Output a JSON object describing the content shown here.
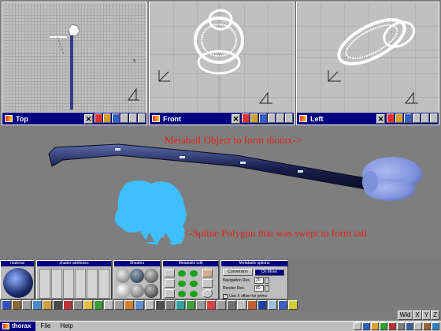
{
  "viewports": [
    {
      "title": "Top"
    },
    {
      "title": "Front"
    },
    {
      "title": "Left"
    }
  ],
  "render": {
    "annotation_metaball": "Metaball Object to form thorax->",
    "annotation_spline": "<-Spline Polygon that was swept to form tail",
    "annotation_color": "#e2231a",
    "spline_color": "#3fbfff",
    "metaball_color": "#8fa6e8"
  },
  "panels": {
    "material_title": "material",
    "shader_attributes_title": "shader attributes",
    "shaders_title": "Shaders",
    "metaball_edit_title": "Metaballs edit",
    "metaball_options_title": "Metaballs options",
    "conversion_label": "Conversion",
    "on_move_label": "On Move",
    "navigation_res_label": "Navigation Res.",
    "navigation_res_value": "20",
    "render_res_label": "Render Res.",
    "render_res_value": "80",
    "use_x_offset_label": "Use X offset for prims",
    "use_x_offset_checked": true
  },
  "wid_buttons": [
    "Wid",
    "X",
    "Y",
    "Z"
  ],
  "menubar": {
    "title": "thorax",
    "items": [
      "File",
      "Help"
    ]
  },
  "icons": {
    "viewport_close": "close-icon",
    "app_logo": "truespace-logo-icon"
  },
  "colors": {
    "title_bar": "#000080",
    "ui_gray": "#bdbdbd",
    "background": "#7d7d7d"
  }
}
